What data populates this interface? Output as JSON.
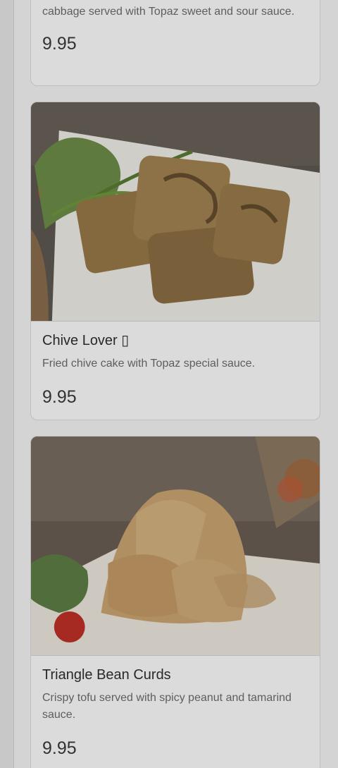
{
  "menu": {
    "items": [
      {
        "description": "cabbage served with Topaz sweet and sour sauce.",
        "price": "9.95"
      },
      {
        "name": "Chive Lover ▯",
        "description": "Fried chive cake with Topaz special sauce.",
        "price": "9.95",
        "image_icon": "food-photo-chive-cake"
      },
      {
        "name": "Triangle Bean Curds",
        "description": "Crispy tofu served with spicy peanut and tamarind sauce.",
        "price": "9.95",
        "image_icon": "food-photo-fried-tofu"
      }
    ]
  },
  "colors": {
    "page_background": "#f7f7f7",
    "card_background": "#ffffff",
    "text_primary": "#2f2f2f",
    "text_secondary": "#6e6e6e",
    "overlay": "rgba(0,0,0,0.14)"
  }
}
